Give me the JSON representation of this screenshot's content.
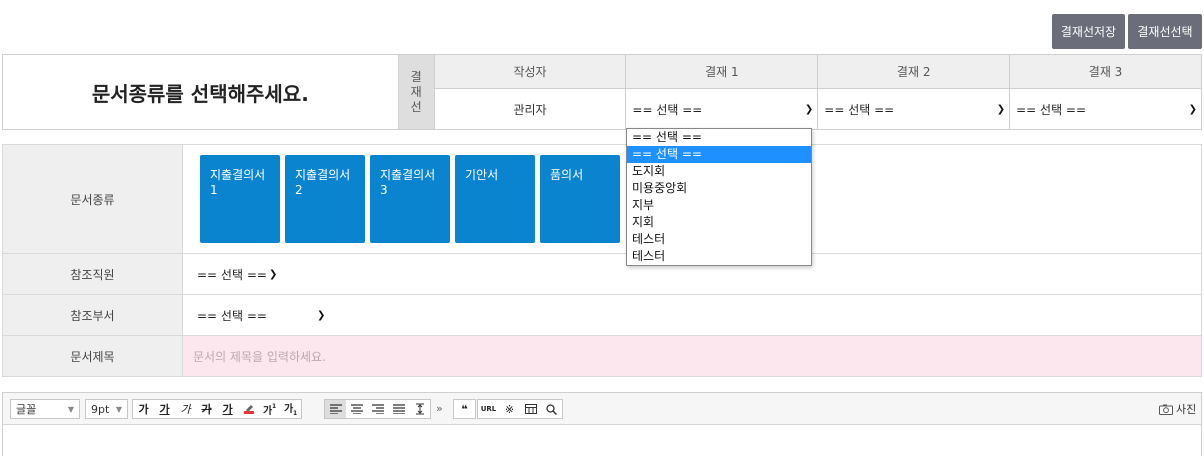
{
  "top_buttons": {
    "save": "결재선저장",
    "select": "결재선선택"
  },
  "approval": {
    "doc_title": "문서종류를 선택해주세요.",
    "vertical_label": [
      "결",
      "재",
      "선"
    ],
    "columns": [
      "작성자",
      "결재 1",
      "결재 2",
      "결재 3"
    ],
    "writer": "관리자",
    "approver1": "== 선택 ==",
    "approver2": "== 선택 ==",
    "approver3": "== 선택 =="
  },
  "dropdown": {
    "options": [
      "== 선택 ==",
      "== 선택 ==",
      "도지회",
      "미용중앙회",
      "지부",
      "지회",
      "테스터",
      "테스터"
    ],
    "highlighted_index": 1
  },
  "form": {
    "doc_type_label": "문서종류",
    "tiles": [
      "지출결의서\n1",
      "지출결의서\n2",
      "지출결의서\n3",
      "기안서",
      "품의서"
    ],
    "ref_staff_label": "참조직원",
    "ref_staff_value": "== 선택 ==",
    "ref_dept_label": "참조부서",
    "ref_dept_value": "== 선택 ==",
    "doc_subject_label": "문서제목",
    "doc_subject_placeholder": "문서의 제목을 입력하세요."
  },
  "editor": {
    "font": "글꼴",
    "size": "9pt",
    "format_buttons": [
      "가",
      "가",
      "가",
      "가",
      "가"
    ],
    "photo": "사진"
  }
}
